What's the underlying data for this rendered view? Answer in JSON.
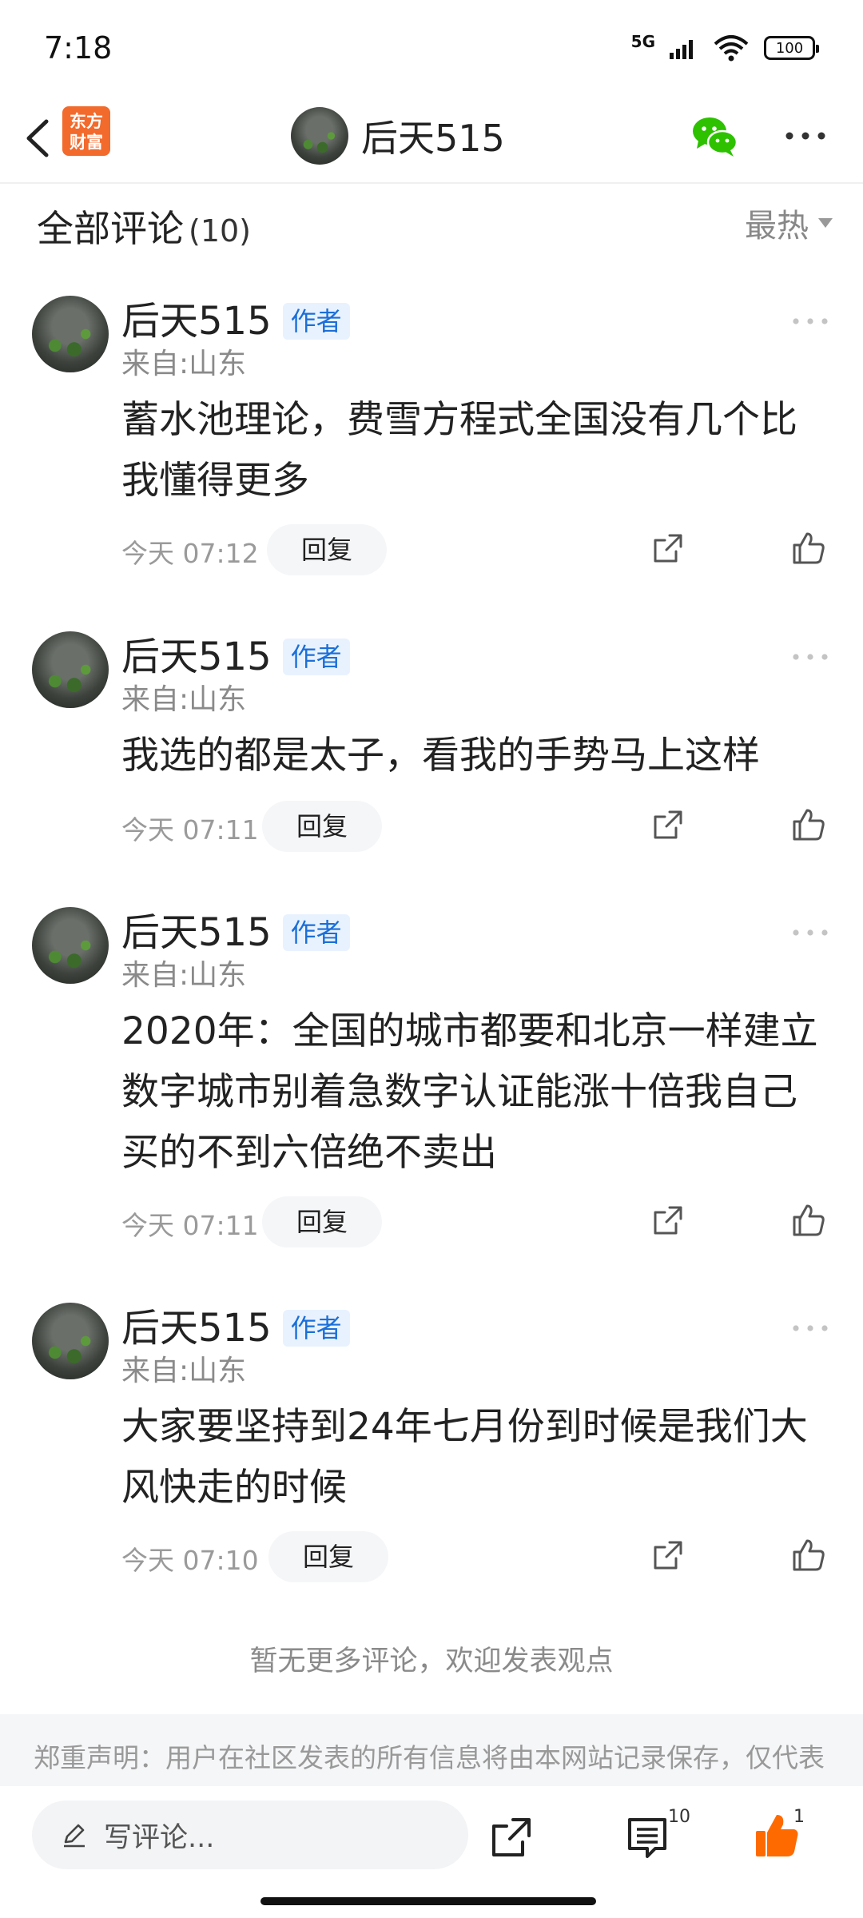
{
  "status_bar": {
    "time": "7:18",
    "network": "5G",
    "battery": "100"
  },
  "nav": {
    "brand_line1": "东方",
    "brand_line2": "财富",
    "title": "后天515",
    "icons": [
      "back-icon",
      "wechat-icon",
      "more-icon"
    ]
  },
  "section": {
    "title": "全部评论",
    "count": "(10)",
    "sort_label": "最热"
  },
  "comments": [
    {
      "name": "后天515",
      "badge": "作者",
      "location": "来自:山东",
      "body": "蓄水池理论，费雪方程式全国没有几个比我懂得更多",
      "time": "今天 07:12",
      "reply": "回复"
    },
    {
      "name": "后天515",
      "badge": "作者",
      "location": "来自:山东",
      "body": "我选的都是太子，看我的手势马上这样",
      "time": "今天 07:11",
      "reply": "回复"
    },
    {
      "name": "后天515",
      "badge": "作者",
      "location": "来自:山东",
      "body": "2020年：全国的城市都要和北京一样建立数字城市别着急数字认证能涨十倍我自己买的不到六倍绝不卖出",
      "time": "今天 07:11",
      "reply": "回复"
    },
    {
      "name": "后天515",
      "badge": "作者",
      "location": "来自:山东",
      "body": "大家要坚持到24年七月份到时候是我们大风快走的时候",
      "time": "今天 07:10",
      "reply": "回复"
    }
  ],
  "no_more_text": "暂无更多评论，欢迎发表观点",
  "disclaimer": "郑重声明：用户在社区发表的所有信息将由本网站记录保存，仅代表",
  "bottom_bar": {
    "input_placeholder": "写评论...",
    "comments_count": "10",
    "like_count": "1"
  },
  "colors": {
    "brand_orange": "#f26a2c",
    "author_badge_blue": "#1b6fd8",
    "wechat_green": "#2dc100",
    "like_orange": "#ff6a00"
  }
}
